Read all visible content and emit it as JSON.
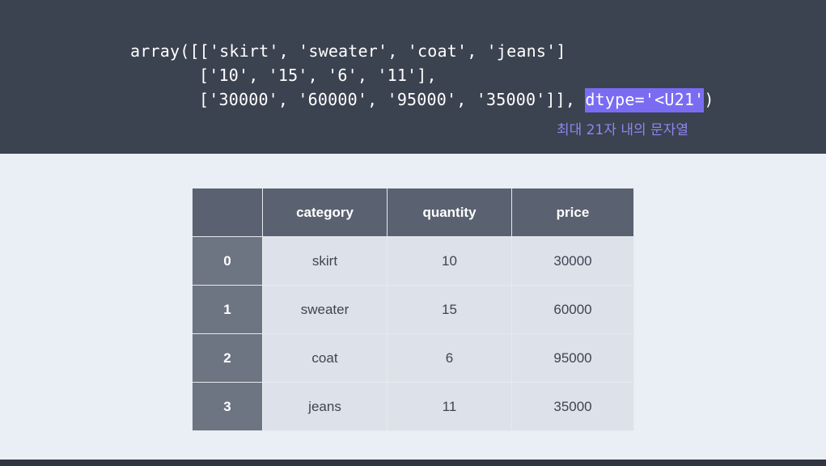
{
  "code": {
    "line1": "array([['skirt', 'sweater', 'coat', 'jeans']",
    "line2": "['10', '15', '6', '11'],",
    "line3_prefix": "['30000', '60000', '95000', '35000']], ",
    "line3_highlight": "dtype='<U21'",
    "line3_suffix": ")",
    "note": "최대 21자 내의 문자열"
  },
  "table": {
    "headers": [
      "",
      "category",
      "quantity",
      "price"
    ],
    "rows": [
      {
        "index": "0",
        "category": "skirt",
        "quantity": "10",
        "price": "30000"
      },
      {
        "index": "1",
        "category": "sweater",
        "quantity": "15",
        "price": "60000"
      },
      {
        "index": "2",
        "category": "coat",
        "quantity": "6",
        "price": "95000"
      },
      {
        "index": "3",
        "category": "jeans",
        "quantity": "11",
        "price": "35000"
      }
    ]
  },
  "colors": {
    "code_background": "#3b4250",
    "highlight": "#7a6cf2",
    "note_text": "#8e86f0",
    "header_background": "#5a6170",
    "index_background": "#6d7482",
    "cell_background": "#dde2ea",
    "page_background": "#eaeff6"
  }
}
